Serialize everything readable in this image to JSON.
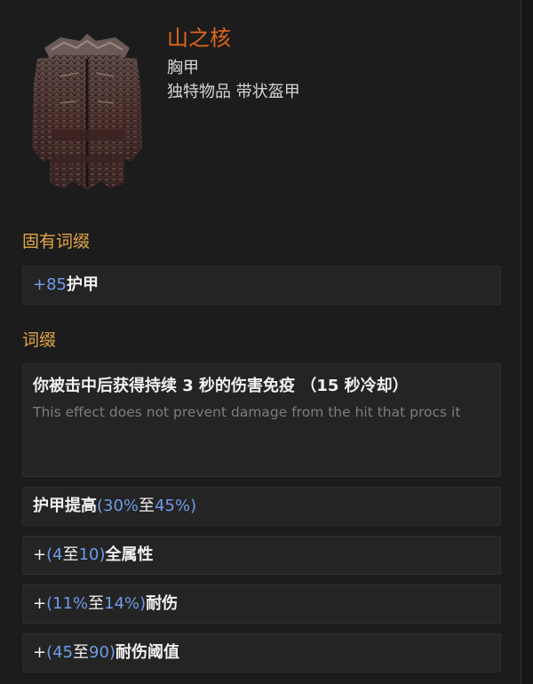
{
  "item": {
    "name": "山之核",
    "class": "胸甲",
    "type": "独特物品 带状盔甲",
    "image_icon": "body-armour-icon"
  },
  "implicit": {
    "title": "固有词缀",
    "mods": [
      {
        "prefix": "+",
        "value": "85",
        "text": " 护甲"
      }
    ]
  },
  "explicit": {
    "title": "词缀",
    "immunity": {
      "text": "你被击中后获得持续 3 秒的伤害免疫 （15 秒冷却）",
      "note": "This effect does not prevent damage from the hit that procs it"
    },
    "armour_increase": {
      "label": "护甲提高",
      "open": "(",
      "min": "30%",
      "to": " 至 ",
      "max": "45%",
      "close": ")"
    },
    "all_attributes": {
      "prefix": "+",
      "open": "(",
      "min": "4",
      "to": " 至 ",
      "max": "10",
      "close": ")",
      "suffix": " 全属性"
    },
    "stun_resist": {
      "prefix": "+",
      "open": "(",
      "min": "11%",
      "to": " 至 ",
      "max": "14%",
      "close": ")",
      "suffix": " 耐伤"
    },
    "stun_threshold": {
      "prefix": "+",
      "open": "(",
      "min": "45",
      "to": " 至 ",
      "max": "90",
      "close": ")",
      "suffix": " 耐伤阈值"
    }
  },
  "colors": {
    "unique_name": "#e0661c",
    "section_title": "#e3a546",
    "value_blue": "#6f9be8",
    "note_grey": "#7d7d7d"
  }
}
